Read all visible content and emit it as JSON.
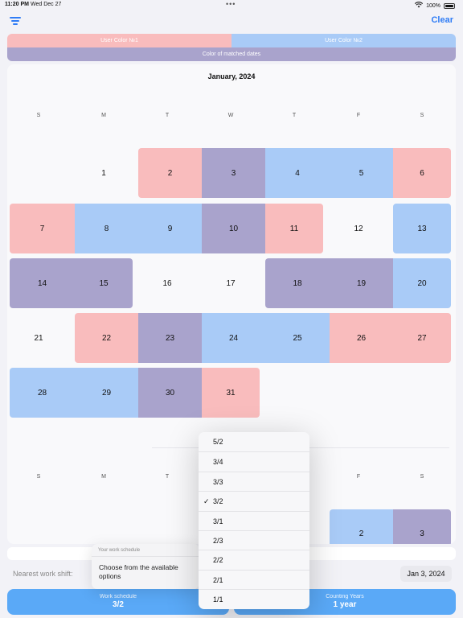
{
  "status": {
    "time": "11:20 PM",
    "date": "Wed Dec 27",
    "dots": "•••",
    "battery": "100%",
    "wifi_icon": "wifi-icon"
  },
  "nav": {
    "clear_label": "Clear",
    "filter_icon": "filter-icon"
  },
  "legend": {
    "user1": "User Color №1",
    "user2": "User Color №2",
    "matched": "Color of matched dates"
  },
  "colors": {
    "user1": "#f9bcbd",
    "user2": "#a9cbf7",
    "matched": "#a9a3cc",
    "accent": "#2f7cf6",
    "button": "#5aa9f7"
  },
  "calendar": {
    "month_title": "January, 2024",
    "weekdays": [
      "S",
      "M",
      "T",
      "W",
      "T",
      "F",
      "S"
    ],
    "weeks": [
      [
        null,
        {
          "d": "1",
          "c": ""
        },
        {
          "d": "2",
          "c": "pink"
        },
        {
          "d": "3",
          "c": "purple"
        },
        {
          "d": "4",
          "c": "blue"
        },
        {
          "d": "5",
          "c": "blue"
        },
        {
          "d": "6",
          "c": "pink"
        }
      ],
      [
        {
          "d": "7",
          "c": "pink"
        },
        {
          "d": "8",
          "c": "blue"
        },
        {
          "d": "9",
          "c": "blue"
        },
        {
          "d": "10",
          "c": "purple"
        },
        {
          "d": "11",
          "c": "pink"
        },
        {
          "d": "12",
          "c": ""
        },
        {
          "d": "13",
          "c": "blue"
        }
      ],
      [
        {
          "d": "14",
          "c": "purple"
        },
        {
          "d": "15",
          "c": "purple"
        },
        {
          "d": "16",
          "c": ""
        },
        {
          "d": "17",
          "c": ""
        },
        {
          "d": "18",
          "c": "purple"
        },
        {
          "d": "19",
          "c": "purple"
        },
        {
          "d": "20",
          "c": "blue"
        }
      ],
      [
        {
          "d": "21",
          "c": ""
        },
        {
          "d": "22",
          "c": "pink"
        },
        {
          "d": "23",
          "c": "purple"
        },
        {
          "d": "24",
          "c": "blue"
        },
        {
          "d": "25",
          "c": "blue"
        },
        {
          "d": "26",
          "c": "pink"
        },
        {
          "d": "27",
          "c": "pink"
        }
      ],
      [
        {
          "d": "28",
          "c": "blue"
        },
        {
          "d": "29",
          "c": "blue"
        },
        {
          "d": "30",
          "c": "purple"
        },
        {
          "d": "31",
          "c": "pink"
        },
        null,
        null,
        null
      ]
    ],
    "next_weekdays": [
      "S",
      "M",
      "T",
      "W",
      "T",
      "F",
      "S"
    ],
    "next_partial": [
      {
        "d": "2",
        "c": "blue",
        "col": 5
      },
      {
        "d": "3",
        "c": "purple",
        "col": 6
      }
    ]
  },
  "nearest": {
    "label": "Nearest work shift:",
    "date": "Jan 3, 2024"
  },
  "buttons": {
    "schedule": {
      "label": "Work schedule",
      "value": "3/2"
    },
    "years": {
      "label": "Counting Years",
      "value": "1 year"
    }
  },
  "tooltip": {
    "title": "Your work schedule",
    "text": "Choose from the available options"
  },
  "menu": {
    "items": [
      "5/2",
      "3/4",
      "3/3",
      "3/2",
      "3/1",
      "2/3",
      "2/2",
      "2/1",
      "1/1"
    ],
    "selected": "3/2",
    "check": "✓"
  }
}
